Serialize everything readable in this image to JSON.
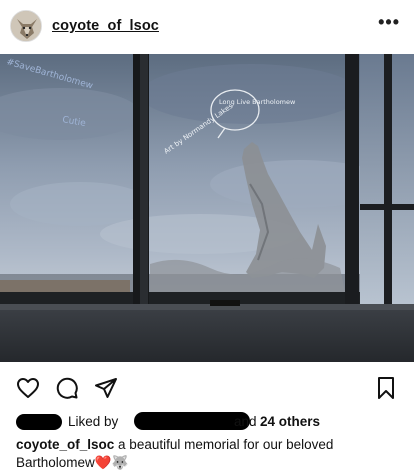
{
  "post": {
    "username": "coyote_of_lsoc",
    "more_label": "•••"
  },
  "photo": {
    "speech_bubble_text": "Long Live Bartholomew",
    "art_credit_text": "Art by Normandy Lakes",
    "window_writing_1": "#SaveBartholomew",
    "window_writing_2": "Cutie"
  },
  "actions": {
    "like_icon": "heart-outline-icon",
    "comment_icon": "comment-bubble-icon",
    "share_icon": "paper-plane-icon",
    "save_icon": "bookmark-icon"
  },
  "likes": {
    "liked_by": "Liked by",
    "and": "and",
    "count": "24 others"
  },
  "caption": {
    "username": "coyote_of_lsoc",
    "text": " a beautiful memorial for our beloved Bartholomew",
    "emojis": "❤️🐺"
  },
  "colors": {
    "background": "#ffffff",
    "text": "#111111",
    "redaction": "#000000"
  }
}
